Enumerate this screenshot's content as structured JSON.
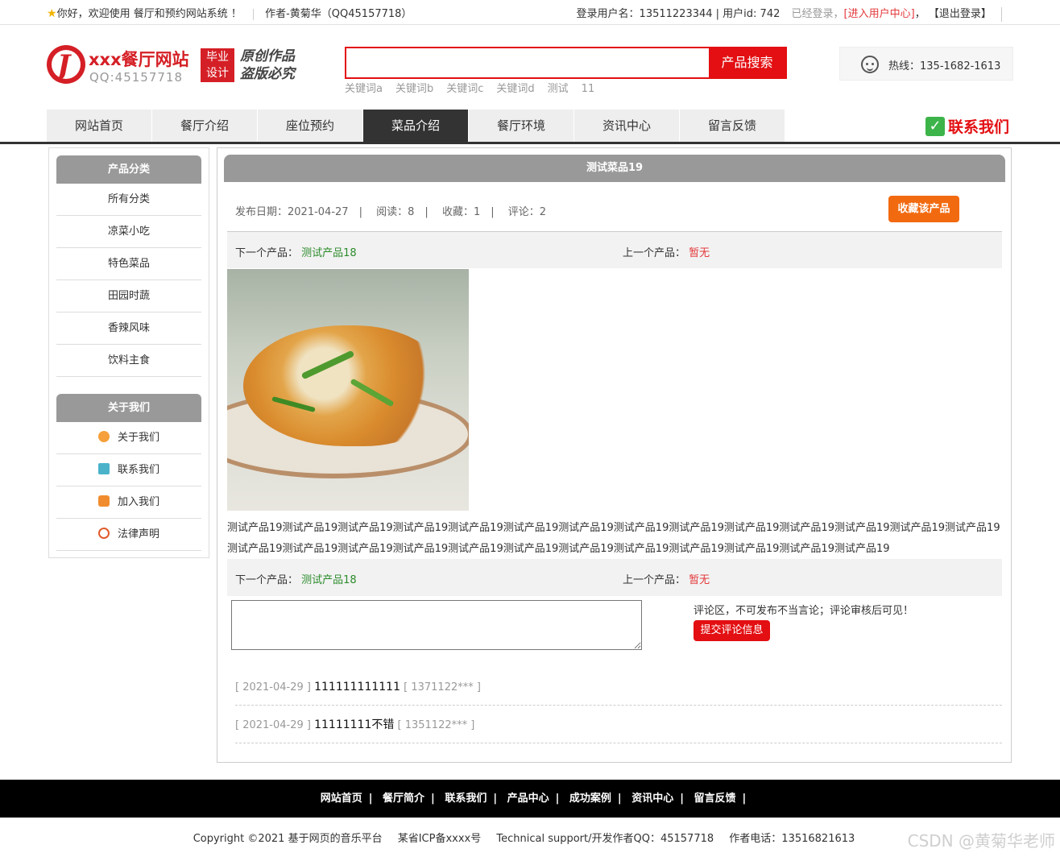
{
  "topbar": {
    "greeting": "你好，欢迎使用 餐厅和预约网站系统 ！",
    "author": "作者-黄菊华（QQ45157718）",
    "login_user": "登录用户名：13511223344 | 用户id: 742",
    "logged_in": "已经登录，",
    "user_center": "[进入用户中心]",
    "comma": "，",
    "logout": "【退出登录】"
  },
  "logo": {
    "title": "xxx餐厅网站",
    "qq": "QQ:45157718",
    "badge_line1": "毕业",
    "badge_line2": "设计",
    "slogan_line1": "原创作品",
    "slogan_line2": "盗版必究"
  },
  "search": {
    "placeholder": "",
    "button": "产品搜索",
    "keywords": [
      "关键词a",
      "关键词b",
      "关键词c",
      "关键词d",
      "测试",
      "11"
    ]
  },
  "hotline": "热线：135-1682-1613",
  "nav": {
    "items": [
      "网站首页",
      "餐厅介绍",
      "座位预约",
      "菜品介绍",
      "餐厅环境",
      "资讯中心",
      "留言反馈"
    ],
    "active_index": 3,
    "contact": "联系我们"
  },
  "sidebar": {
    "category_title": "产品分类",
    "categories": [
      "所有分类",
      "凉菜小吃",
      "特色菜品",
      "田园时蔬",
      "香辣风味",
      "饮料主食"
    ],
    "about_title": "关于我们",
    "about_items": [
      {
        "label": "关于我们",
        "icon": "about-icon"
      },
      {
        "label": "联系我们",
        "icon": "contact-card-icon"
      },
      {
        "label": "加入我们",
        "icon": "lock-icon"
      },
      {
        "label": "法律声明",
        "icon": "power-icon"
      }
    ]
  },
  "product": {
    "title": "测试菜品19",
    "publish_label": "发布日期：",
    "publish_date": "2021-04-27",
    "views_label": "阅读：",
    "views": "8",
    "favs_label": "收藏：",
    "favs": "1",
    "comments_label": "评论：",
    "comments": "2",
    "fav_button": "收藏该产品",
    "next_label": "下一个产品：",
    "next_value": "测试产品18",
    "prev_label": "上一个产品：",
    "prev_value": "暂无",
    "description": "测试产品19测试产品19测试产品19测试产品19测试产品19测试产品19测试产品19测试产品19测试产品19测试产品19测试产品19测试产品19测试产品19测试产品19测试产品19测试产品19测试产品19测试产品19测试产品19测试产品19测试产品19测试产品19测试产品19测试产品19测试产品19测试产品19"
  },
  "comment_form": {
    "note": "评论区，不可发布不当言论；评论审核后可见！",
    "submit": "提交评论信息"
  },
  "comments": [
    {
      "date": "[ 2021-04-29 ]",
      "text": "111111111111",
      "user": "[ 1371122*** ]"
    },
    {
      "date": "[ 2021-04-29 ]",
      "text": "11111111不错",
      "user": "[ 1351122*** ]"
    }
  ],
  "footer": {
    "links": [
      "网站首页",
      "餐厅简介",
      "联系我们",
      "产品中心",
      "成功案例",
      "资讯中心",
      "留言反馈"
    ],
    "separator": "|",
    "copyright": "Copyright ©2021 基于网页的音乐平台",
    "icp": "某省ICP备xxxx号",
    "support": "Technical support/开发作者QQ：45157718",
    "phone": "作者电话：13516821613"
  },
  "watermark": "CSDN @黄菊华老师",
  "colors": {
    "brand_red": "#e30f12",
    "orange": "#f26a10",
    "nav_active": "#333333",
    "green_link": "#2b8b2b"
  }
}
